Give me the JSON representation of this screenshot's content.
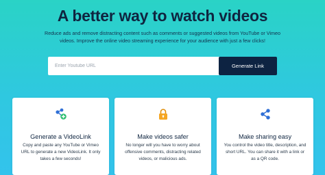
{
  "hero": {
    "title": "A better way to watch videos",
    "subtitle": "Reduce ads and remove distracting content such as comments or suggested videos from YouTube or Vimeo videos. Improve the online video streaming experience for your audience with just a few clicks!"
  },
  "form": {
    "url_placeholder": "Enter Youtube URL",
    "url_value": "",
    "generate_label": "Generate Link"
  },
  "features": [
    {
      "icon": "share-plus-icon",
      "title": "Generate a VideoLink",
      "description": "Copy and paste any YouTube or Vimeo URL to generate a new VideoLink. It only takes a few seconds!"
    },
    {
      "icon": "lock-icon",
      "title": "Make videos safer",
      "description": "No longer will you have to worry about offensive comments, distracting related videos, or malicious ads."
    },
    {
      "icon": "share-icon",
      "title": "Make sharing easy",
      "description": "You control the video title, description, and short URL. You can share it with a link or as a QR code."
    }
  ],
  "colors": {
    "navy": "#0d2342",
    "accent_blue": "#2f6fd6",
    "accent_green": "#2fbf71",
    "lock_orange": "#f5a623"
  }
}
